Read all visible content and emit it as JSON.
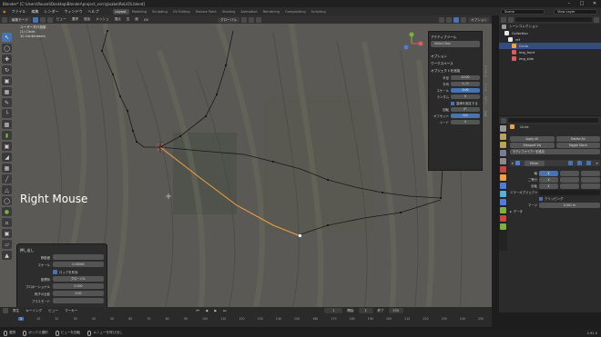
{
  "window": {
    "title": "Blender* [C:\\Users\\Rousel\\Desktop\\Blender\\project_vsrc\\g\\sabe\\ReLiOS.blend]",
    "controls": [
      "–",
      "□",
      "✕"
    ]
  },
  "menu": {
    "items": [
      "ファイル",
      "編集",
      "レンダー",
      "ウィンドウ",
      "ヘルプ"
    ],
    "workspaces": [
      "Layout",
      "Modeling",
      "Sculpting",
      "UV Editing",
      "Texture Paint",
      "Shading",
      "Animation",
      "Rendering",
      "Compositing",
      "Scripting"
    ],
    "active_workspace": "Layout",
    "scene": "Scene",
    "view_layer": "View Layer"
  },
  "viewport_header": {
    "mode": "編集モード",
    "menus": [
      "ビュー",
      "選択",
      "追加",
      "メッシュ",
      "頂点",
      "辺",
      "面",
      "UV"
    ],
    "transform": "グローバル",
    "options": "オプション"
  },
  "viewport": {
    "info_lines": [
      "ユーザー平行投影",
      "(1) Circle",
      "10 Centimeters"
    ],
    "overlay_label": "Right Mouse"
  },
  "toolbar": {
    "tools": [
      "cursor",
      "select",
      "move",
      "rotate",
      "scale",
      "transform",
      "annotate",
      "measure",
      "add-cube",
      "extrude",
      "inset",
      "bevel",
      "loop-cut",
      "knife",
      "poly-build",
      "spin",
      "smooth",
      "edge-slide",
      "shrink",
      "shear",
      "rip"
    ]
  },
  "npanel": {
    "sections": [
      "アクティブツール",
      "オプション",
      "ワークスペース",
      "オブジェクトを追加"
    ],
    "select_box": "Select Box",
    "rows": [
      {
        "label": "半径",
        "value": "10.00"
      },
      {
        "label": "平均",
        "value": "1 / 0"
      },
      {
        "label": "スケール",
        "value": "0.00"
      },
      {
        "label": "ランダム",
        "value": "0"
      }
    ],
    "checkbox_label": "直線を固定する",
    "rows2": [
      {
        "label": "回転",
        "value": "0°"
      },
      {
        "label": "オフセット",
        "value": "0.0"
      },
      {
        "label": "シード",
        "value": "0"
      }
    ],
    "tabs": [
      "アイテム",
      "ツール",
      "ビュー",
      "Edit"
    ]
  },
  "last_operation": {
    "title": "押し出し",
    "rows": [
      {
        "label": "移動度",
        "value": ""
      },
      {
        "label": "スケール",
        "value": "0.00000"
      }
    ],
    "checkbox": "ロックを有効",
    "rows2": [
      {
        "label": "座標系",
        "value": "グローバル"
      },
      {
        "label": "プロポーショナル",
        "value": "0.000"
      },
      {
        "label": "粍子の近影",
        "value": "0.00"
      },
      {
        "label": "プラスモード",
        "value": ""
      }
    ]
  },
  "outliner": {
    "title": "シーンコレクション",
    "items": [
      {
        "label": "Collection",
        "color": "#e6e6e6",
        "indent": 0
      },
      {
        "label": "ref",
        "color": "#e6e6e6",
        "indent": 1
      },
      {
        "label": "Circle",
        "color": "#f2a23a",
        "indent": 2,
        "selected": true
      },
      {
        "label": "img_front",
        "color": "#e05a5a",
        "indent": 2
      },
      {
        "label": "img_side",
        "color": "#e05a5a",
        "indent": 2
      }
    ]
  },
  "properties": {
    "object_name": "Circle",
    "buttons_a": [
      "Apply All",
      "Delete All"
    ],
    "buttons_b": [
      "Viewport Vis",
      "Toggle Stack"
    ],
    "add_modifier": "モディファイアーを追加",
    "modifier": "Mirror",
    "axis_rows": [
      {
        "label": "軸",
        "value": "X"
      },
      {
        "label": "二等分",
        "value": "X"
      },
      {
        "label": "反転",
        "value": "X"
      }
    ],
    "mirror_object_label": "ミラーオブジェクト",
    "clipping": "クリッピング",
    "merge": "マージ",
    "merge_value": "0.001 m",
    "data_section": "データ"
  },
  "timeline": {
    "menus": [
      "再生",
      "キーイング",
      "ビュー",
      "マーカー"
    ],
    "current_frame": "1",
    "start_label": "開始",
    "start": "1",
    "end_label": "終了",
    "end": "250",
    "ruler": [
      "1",
      "10",
      "20",
      "30",
      "40",
      "50",
      "60",
      "70",
      "80",
      "90",
      "100",
      "110",
      "120",
      "130",
      "140",
      "150",
      "160",
      "170",
      "180",
      "190",
      "200",
      "210",
      "220",
      "230",
      "240",
      "250"
    ]
  },
  "status": {
    "items": [
      "選択",
      "ボックス選択",
      "ビューを回転",
      "メニューを呼び出し"
    ],
    "version": "2.92.0"
  },
  "colors": {
    "accent": "#4772b3",
    "edge_selected": "#f2a23a",
    "viewport_bg": "#575653"
  }
}
